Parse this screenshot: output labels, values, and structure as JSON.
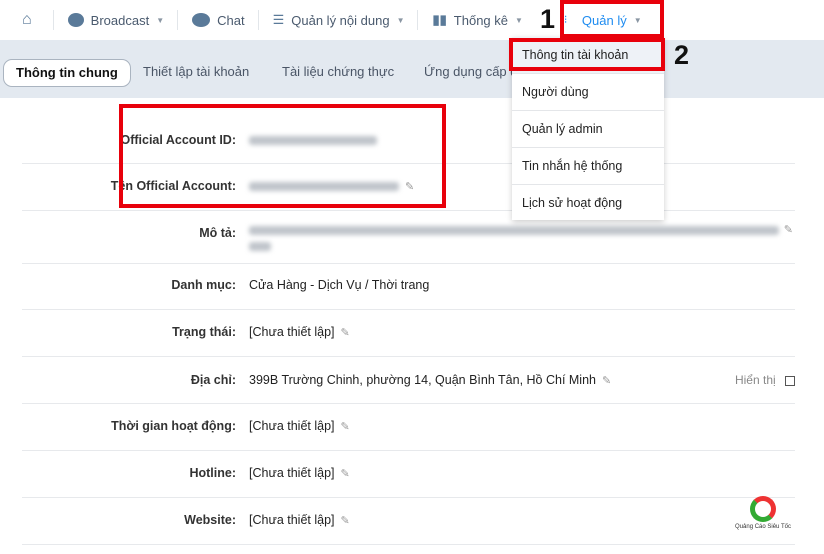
{
  "topnav": {
    "items": [
      {
        "label": "",
        "icon": "home-icon"
      },
      {
        "label": "Broadcast",
        "icon": "speech-bubble-icon",
        "caret": true
      },
      {
        "label": "Chat",
        "icon": "chat-bubbles-icon"
      },
      {
        "label": "Quản lý nội dung",
        "icon": "list-icon",
        "caret": true
      },
      {
        "label": "Thống kê",
        "icon": "bar-chart-icon",
        "caret": true
      },
      {
        "label": "Quản lý",
        "icon": "grid-icon",
        "caret": true
      }
    ],
    "active_color": "#1f8cf0"
  },
  "tabs": [
    "Thông tin chung",
    "Thiết lập tài khoản",
    "Tài liệu chứng thực",
    "Ứng dụng cấp q"
  ],
  "dropdown": [
    "Thông tin tài khoản",
    "Người dùng",
    "Quản lý admin",
    "Tin nhắn hệ thống",
    "Lịch sử hoạt động"
  ],
  "annotations": {
    "step1": "1",
    "step2": "2",
    "highlight_color": "#e8000b"
  },
  "fields": [
    {
      "label": "Official Account ID:"
    },
    {
      "label": "Tên Official Account:"
    },
    {
      "label": "Mô tả:"
    },
    {
      "label": "Danh mục:",
      "value": "Cửa Hàng - Dịch Vụ / Thời trang"
    },
    {
      "label": "Trạng thái:",
      "value": "[Chưa thiết lập]"
    },
    {
      "label": "Địa chỉ:",
      "value": "399B Trường Chinh, phường 14, Quận Bình Tân, Hồ Chí Minh"
    },
    {
      "label": "Thời gian hoạt động:",
      "value": "[Chưa thiết lập]"
    },
    {
      "label": "Hotline:",
      "value": "[Chưa thiết lập]"
    },
    {
      "label": "Website:",
      "value": "[Chưa thiết lập]"
    }
  ],
  "show_label": "Hiển thị",
  "watermark": {
    "text": "Quảng Cáo Siêu Tốc"
  }
}
